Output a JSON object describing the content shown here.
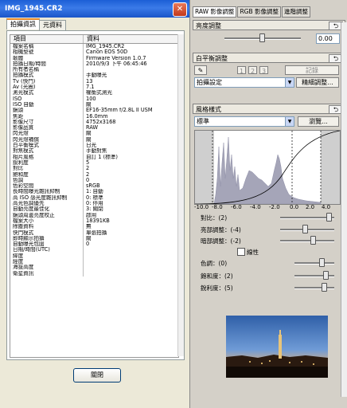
{
  "dialog": {
    "title": "IMG_1945.CR2",
    "tabs": [
      "拍攝資訊",
      "元資料"
    ],
    "col_item": "項目",
    "col_data": "資料",
    "rows": [
      [
        "檔案名稱",
        "IMG_1945.CR2"
      ],
      [
        "相機型號",
        "Canon EOS 50D"
      ],
      [
        "韌體",
        "Firmware Version 1.0.7"
      ],
      [
        "拍攝日期/時間",
        "2010/9/3 下午 06:45:46"
      ],
      [
        "所有者名稱",
        ""
      ],
      [
        "拍攝模式",
        "手動曝光"
      ],
      [
        "Tv (快門)",
        "13"
      ],
      [
        "Av (光圈)",
        "7.1"
      ],
      [
        "測光模式",
        "權衡式測光"
      ],
      [
        "ISO",
        "100"
      ],
      [
        "ISO 自動",
        "關"
      ],
      [
        "鏡頭",
        "EF16-35mm f/2.8L II USM"
      ],
      [
        "焦距",
        "16.0mm"
      ],
      [
        "影像尺寸",
        "4752x3168"
      ],
      [
        "影像品質",
        "RAW"
      ],
      [
        "閃光燈",
        "關"
      ],
      [
        "閃光燈補償",
        "關"
      ],
      [
        "白平衡模式",
        "日光"
      ],
      [
        "對焦模式",
        "手動對焦"
      ],
      [
        "相片風格",
        "自訂 1 (標準)"
      ],
      [
        "銳利度",
        "5"
      ],
      [
        "對比",
        "2"
      ],
      [
        "飽和度",
        "2"
      ],
      [
        "色調",
        "0"
      ],
      [
        "色彩空間",
        "sRGB"
      ],
      [
        "長時間曝光雜訊抑制",
        "1: 自動"
      ],
      [
        "高 ISO 感光度雜訊抑制",
        "0: 標準"
      ],
      [
        "高光色調優先",
        "0: 停用"
      ],
      [
        "自動亮度最佳化",
        "3: 關閉"
      ],
      [
        "鏡頭周邊亮度校正",
        "啟用"
      ],
      [
        "檔案大小",
        "18391KB"
      ],
      [
        "除塵資料",
        "無"
      ],
      [
        "快門模式",
        "單張拍攝"
      ],
      [
        "即時顯示拍攝",
        "關"
      ],
      [
        "自動曝光包圍",
        "0"
      ],
      [
        "日期/時間(UTC)",
        ""
      ],
      [
        "緯度",
        ""
      ],
      [
        "經度",
        ""
      ],
      [
        "海拔高度",
        ""
      ],
      [
        "衛星資訊",
        ""
      ]
    ],
    "close_label": "關閉"
  },
  "palette": {
    "tabs": [
      "RAW 影像調整",
      "RGB 影像調整",
      "進階調整"
    ],
    "brightness": {
      "title": "亮度調整",
      "value": "0.00"
    },
    "white_balance": {
      "title": "白平衡調整",
      "presets": [
        "1",
        "2",
        "3"
      ],
      "register_label": "記錄",
      "mode_value": "拍攝設定",
      "fine_tune_label": "精細調整..."
    },
    "picture_style": {
      "title": "風格樣式",
      "value": "標準",
      "browse_label": "瀏覽...",
      "axis_ticks": [
        "-10.0",
        "-8.0",
        "-6.0",
        "-4.0",
        "-2.0",
        "0.0",
        "2.0",
        "4.0"
      ],
      "contrast_label": "對比：(2)",
      "highlight_label": "亮部調整：(-4)",
      "shadow_label": "暗部調整：(-2)",
      "linear_label": "線性",
      "color_tone_label": "色調：(0)",
      "saturation_label": "飽和度：(2)",
      "sharpness_label": "銳利度：(5)",
      "contrast": 2,
      "highlight": -4,
      "shadow": -2,
      "color_tone": 0,
      "saturation": 2,
      "sharpness": 5
    }
  }
}
